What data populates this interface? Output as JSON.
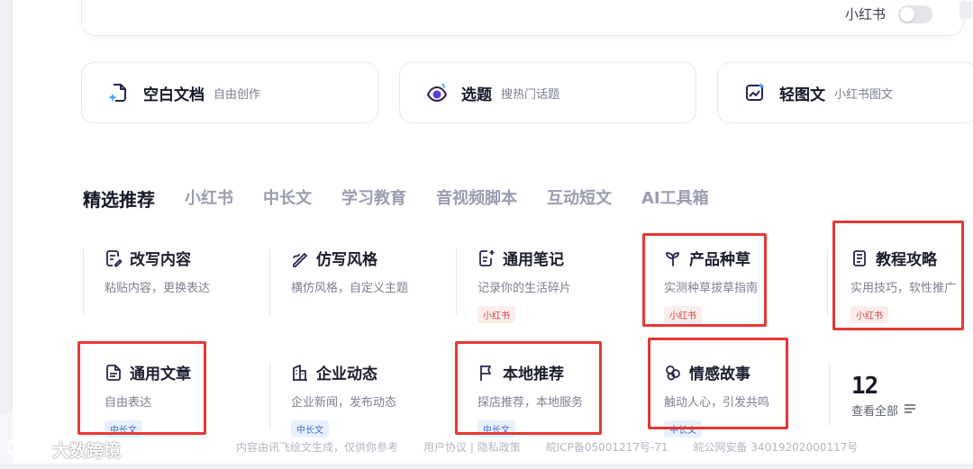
{
  "top": {
    "xhs_label": "小红书",
    "xhs_toggle_on": false
  },
  "quick": [
    {
      "title": "空白文档",
      "sub": "自由创作",
      "icon": "new-document-icon"
    },
    {
      "title": "选题",
      "sub": "搜热门话题",
      "icon": "eye-target-icon"
    },
    {
      "title": "轻图文",
      "sub": "小红书图文",
      "icon": "image-chart-icon"
    }
  ],
  "tabs": [
    "精选推荐",
    "小红书",
    "中长文",
    "学习教育",
    "音视频脚本",
    "互动短文",
    "AI工具箱"
  ],
  "templates": [
    {
      "title": "改写内容",
      "desc": "粘贴内容，更换表达",
      "tag": "",
      "icon": "edit-doc-icon"
    },
    {
      "title": "仿写风格",
      "desc": "横仿风格，自定义主题",
      "tag": "",
      "icon": "pen-wave-icon"
    },
    {
      "title": "通用笔记",
      "desc": "记录你的生活碎片",
      "tag": "小红书",
      "icon": "note-plus-icon"
    },
    {
      "title": "产品种草",
      "desc": "实测种草拔草指南",
      "tag": "小红书",
      "icon": "sprout-icon"
    },
    {
      "title": "教程攻略",
      "desc": "实用技巧，软性推广",
      "tag": "小红书",
      "icon": "book-list-icon"
    },
    {
      "title": "通用文章",
      "desc": "自由表达",
      "tag": "中长文",
      "icon": "article-icon"
    },
    {
      "title": "企业动态",
      "desc": "企业新闻，发布动态",
      "tag": "中长文",
      "icon": "building-icon"
    },
    {
      "title": "本地推荐",
      "desc": "探店推荐，本地服务",
      "tag": "中长文",
      "icon": "flag-icon"
    },
    {
      "title": "情感故事",
      "desc": "触动人心，引发共鸣",
      "tag": "中长文",
      "icon": "heart-clover-icon"
    }
  ],
  "count": {
    "number": "12",
    "view_all": "查看全部"
  },
  "footer": {
    "notice": "内容由讯飞绘文生成，仅供你参考",
    "links": "用户协议 | 隐私政策",
    "icp": "皖ICP备05001217号-71",
    "police": "皖公网安备 34019202000117号"
  },
  "watermark": "大数跨境",
  "colors": {
    "accent": "#5b3bd6",
    "highlight": "#e53935",
    "tag_red": "#d2453e",
    "tag_blue": "#3c6fd4"
  }
}
